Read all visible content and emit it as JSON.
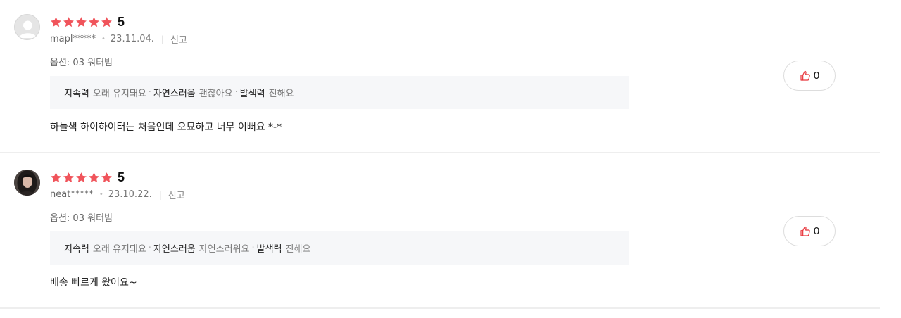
{
  "colors": {
    "star": "#f0545b",
    "like_icon": "#e8343a"
  },
  "reviews": [
    {
      "avatar": "default-avatar",
      "rating": 5,
      "score_label": "5",
      "user": "mapl*****",
      "date": "23.11.04.",
      "report_label": "신고",
      "option": "옵션: 03 워터빔",
      "attributes": [
        {
          "key": "지속력",
          "value": "오래 유지돼요"
        },
        {
          "key": "자연스러움",
          "value": "괜찮아요"
        },
        {
          "key": "발색력",
          "value": "진해요"
        }
      ],
      "content": "하늘색 하이하이터는 처음인데 오묘하고 너무 이뻐요 *-*",
      "like_count": "0"
    },
    {
      "avatar": "profile-photo",
      "rating": 5,
      "score_label": "5",
      "user": "neat*****",
      "date": "23.10.22.",
      "report_label": "신고",
      "option": "옵션: 03 워터빔",
      "attributes": [
        {
          "key": "지속력",
          "value": "오래 유지돼요"
        },
        {
          "key": "자연스러움",
          "value": "자연스러워요"
        },
        {
          "key": "발색력",
          "value": "진해요"
        }
      ],
      "content": "배송 빠르게 왔어요~",
      "like_count": "0"
    }
  ]
}
